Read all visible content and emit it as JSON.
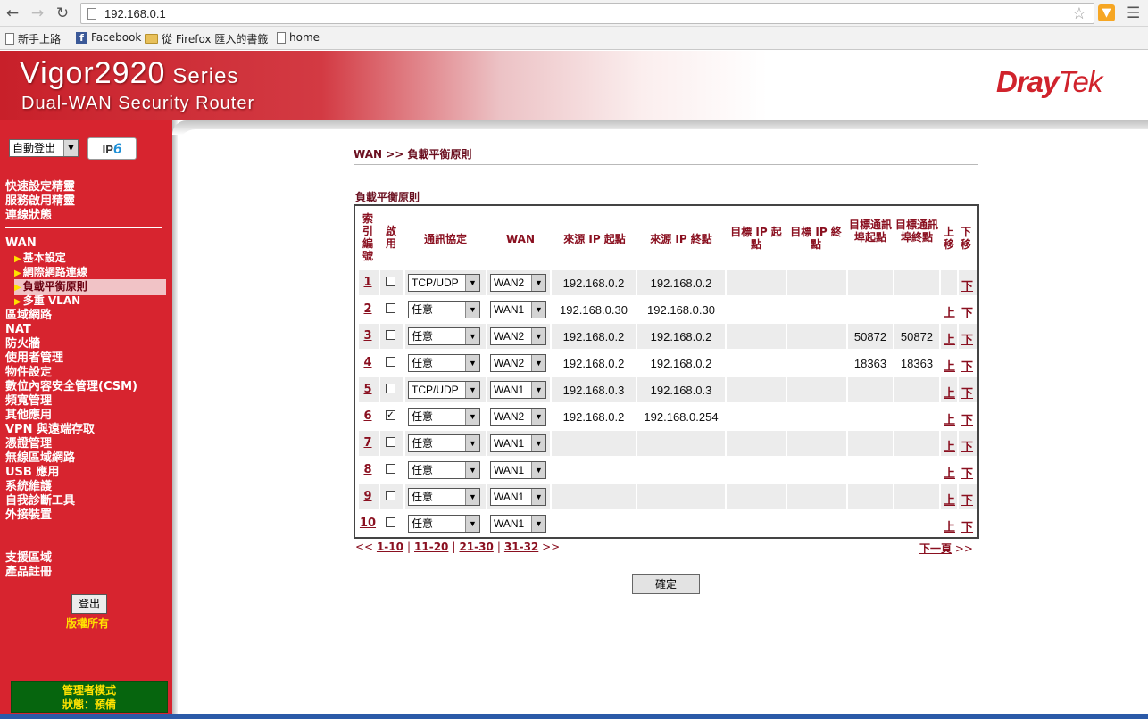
{
  "browser": {
    "url": "192.168.0.1",
    "bookmarks": [
      "新手上路",
      "Facebook",
      "從 Firefox 匯入的書籤",
      "home"
    ]
  },
  "banner": {
    "model": "Vigor2920",
    "series": "Series",
    "subtitle": "Dual-WAN Security Router",
    "brand_dray": "Dray",
    "brand_tek": "Tek"
  },
  "sidebar": {
    "language": "自動登出",
    "ipv6_badge": "IPv6",
    "top_links": [
      "快速設定精靈",
      "服務啟用精靈",
      "連線狀態"
    ],
    "wan": "WAN",
    "wan_sub": [
      "基本設定",
      "網際網路連線",
      "負載平衡原則",
      "多重 VLAN"
    ],
    "menu": [
      "區域網路",
      "NAT",
      "防火牆",
      "使用者管理",
      "物件設定",
      "數位內容安全管理(CSM)",
      "頻寬管理",
      "其他應用",
      "VPN 與遠端存取",
      "憑證管理",
      "無線區域網路",
      "USB 應用",
      "系統維護",
      "自我診斷工具",
      "外接裝置"
    ],
    "support": [
      "支援區域",
      "產品註冊"
    ],
    "logout": "登出",
    "rights": "版權所有",
    "mode_line1": "管理者模式",
    "mode_line2": "狀態：預備"
  },
  "main": {
    "breadcrumb": "WAN >> 負載平衡原則",
    "section_title": "負載平衡原則",
    "headers": {
      "index": "索引編號",
      "enable": "啟用",
      "protocol": "通訊協定",
      "wan": "WAN",
      "src_start": "來源 IP 起點",
      "src_end": "來源 IP 終點",
      "dst_ip_start": "目標 IP 起點",
      "dst_ip_end": "目標 IP 終點",
      "dst_port_start": "目標通訊埠起點",
      "dst_port_end": "目標通訊埠終點",
      "move_up": "上移",
      "move_down": "下移"
    },
    "rows": [
      {
        "index": "1",
        "enabled": false,
        "protocol": "TCP/UDP",
        "wan": "WAN2",
        "src_start": "192.168.0.2",
        "src_end": "192.168.0.2",
        "dst_ip_start": "",
        "dst_ip_end": "",
        "dst_port_start": "",
        "dst_port_end": "",
        "up": "",
        "down": "下"
      },
      {
        "index": "2",
        "enabled": false,
        "protocol": "任意",
        "wan": "WAN1",
        "src_start": "192.168.0.30",
        "src_end": "192.168.0.30",
        "dst_ip_start": "",
        "dst_ip_end": "",
        "dst_port_start": "",
        "dst_port_end": "",
        "up": "上",
        "down": "下"
      },
      {
        "index": "3",
        "enabled": false,
        "protocol": "任意",
        "wan": "WAN2",
        "src_start": "192.168.0.2",
        "src_end": "192.168.0.2",
        "dst_ip_start": "",
        "dst_ip_end": "",
        "dst_port_start": "50872",
        "dst_port_end": "50872",
        "up": "上",
        "down": "下"
      },
      {
        "index": "4",
        "enabled": false,
        "protocol": "任意",
        "wan": "WAN2",
        "src_start": "192.168.0.2",
        "src_end": "192.168.0.2",
        "dst_ip_start": "",
        "dst_ip_end": "",
        "dst_port_start": "18363",
        "dst_port_end": "18363",
        "up": "上",
        "down": "下"
      },
      {
        "index": "5",
        "enabled": false,
        "protocol": "TCP/UDP",
        "wan": "WAN1",
        "src_start": "192.168.0.3",
        "src_end": "192.168.0.3",
        "dst_ip_start": "",
        "dst_ip_end": "",
        "dst_port_start": "",
        "dst_port_end": "",
        "up": "上",
        "down": "下"
      },
      {
        "index": "6",
        "enabled": true,
        "protocol": "任意",
        "wan": "WAN2",
        "src_start": "192.168.0.2",
        "src_end": "192.168.0.254",
        "dst_ip_start": "",
        "dst_ip_end": "",
        "dst_port_start": "",
        "dst_port_end": "",
        "up": "上",
        "down": "下"
      },
      {
        "index": "7",
        "enabled": false,
        "protocol": "任意",
        "wan": "WAN1",
        "src_start": "",
        "src_end": "",
        "dst_ip_start": "",
        "dst_ip_end": "",
        "dst_port_start": "",
        "dst_port_end": "",
        "up": "上",
        "down": "下"
      },
      {
        "index": "8",
        "enabled": false,
        "protocol": "任意",
        "wan": "WAN1",
        "src_start": "",
        "src_end": "",
        "dst_ip_start": "",
        "dst_ip_end": "",
        "dst_port_start": "",
        "dst_port_end": "",
        "up": "上",
        "down": "下"
      },
      {
        "index": "9",
        "enabled": false,
        "protocol": "任意",
        "wan": "WAN1",
        "src_start": "",
        "src_end": "",
        "dst_ip_start": "",
        "dst_ip_end": "",
        "dst_port_start": "",
        "dst_port_end": "",
        "up": "上",
        "down": "下"
      },
      {
        "index": "10",
        "enabled": false,
        "protocol": "任意",
        "wan": "WAN1",
        "src_start": "",
        "src_end": "",
        "dst_ip_start": "",
        "dst_ip_end": "",
        "dst_port_start": "",
        "dst_port_end": "",
        "up": "上",
        "down": "下"
      }
    ],
    "pager": {
      "prev": "<<",
      "pages": [
        "1-10",
        "11-20",
        "21-30",
        "31-32"
      ],
      "next": ">>",
      "next_page": "下一頁",
      "next_arrow": ">>"
    },
    "ok_button": "確定"
  }
}
